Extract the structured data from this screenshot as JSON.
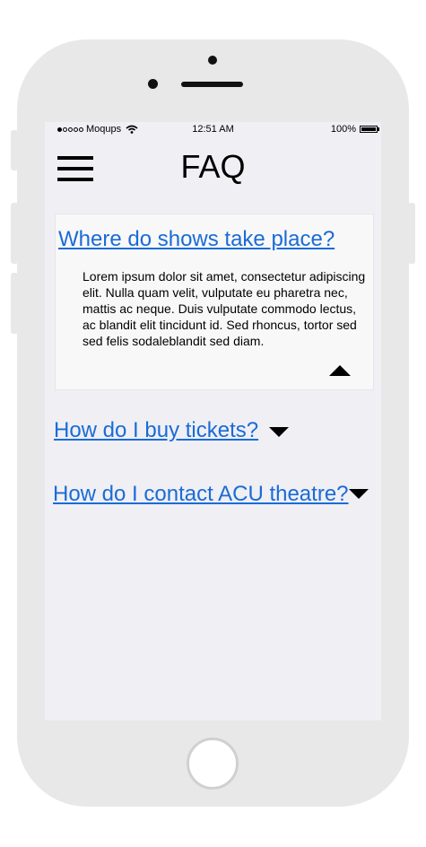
{
  "status_bar": {
    "carrier": "Moqups",
    "time": "12:51 AM",
    "battery": "100%"
  },
  "header": {
    "title": "FAQ"
  },
  "faq": {
    "items": [
      {
        "question": "Where do shows take place?",
        "answer": "Lorem ipsum dolor sit amet, consectetur adipiscing elit. Nulla quam velit, vulputate eu pharetra nec, mattis ac neque. Duis vulputate commodo lectus, ac blandit elit tincidunt id. Sed rhoncus, tortor sed sed felis sodaleblandit sed diam.",
        "expanded": true
      },
      {
        "question": "How do I buy tickets?",
        "expanded": false
      },
      {
        "question": "How do I contact ACU theatre?",
        "expanded": false
      }
    ]
  },
  "colors": {
    "link": "#1a6bd6",
    "screen_background": "#efeff4",
    "device_body": "#e8e8e8"
  },
  "icons": [
    "menu-icon",
    "wifi-icon",
    "battery-icon",
    "collapse-arrow-icon",
    "expand-arrow-icon"
  ]
}
